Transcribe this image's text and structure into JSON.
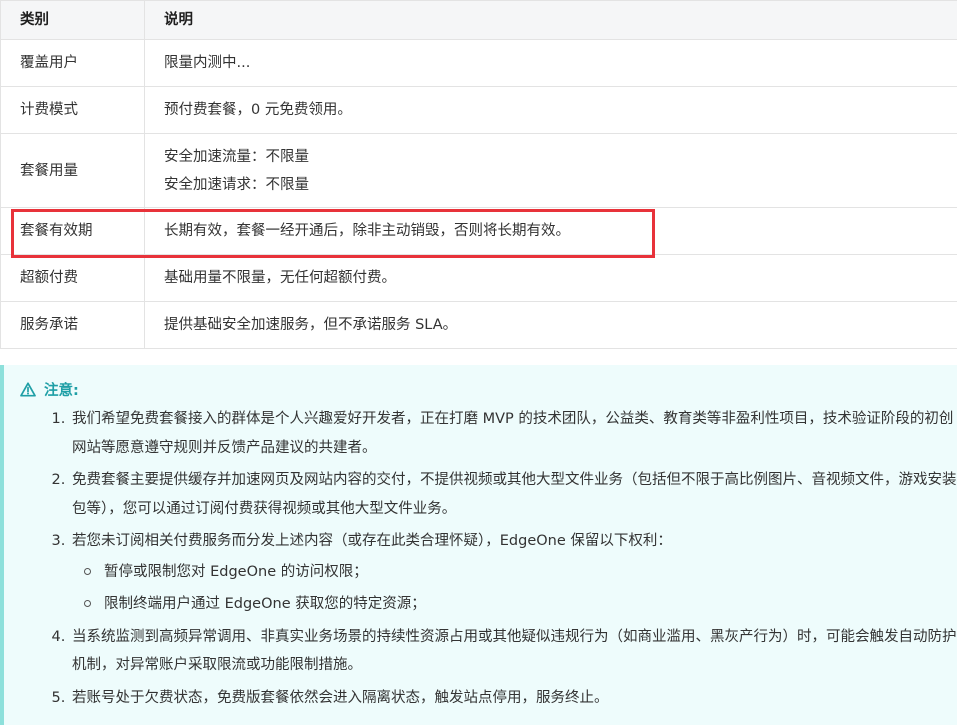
{
  "table": {
    "headers": [
      "类别",
      "说明"
    ],
    "rows": [
      {
        "category": "覆盖用户",
        "desc": [
          "限量内测中..."
        ]
      },
      {
        "category": "计费模式",
        "desc": [
          "预付费套餐，0 元免费领用。"
        ]
      },
      {
        "category": "套餐用量",
        "desc": [
          "安全加速流量：不限量",
          "安全加速请求：不限量"
        ]
      },
      {
        "category": "套餐有效期",
        "desc": [
          "长期有效，套餐一经开通后，除非主动销毁，否则将长期有效。"
        ]
      },
      {
        "category": "超额付费",
        "desc": [
          "基础用量不限量，无任何超额付费。"
        ]
      },
      {
        "category": "服务承诺",
        "desc": [
          "提供基础安全加速服务，但不承诺服务 SLA。"
        ]
      }
    ]
  },
  "notice": {
    "title": "注意:",
    "icon": "warning-triangle-icon",
    "points": [
      "我们希望免费套餐接入的群体是个人兴趣爱好开发者，正在打磨 MVP 的技术团队，公益类、教育类等非盈利性项目，技术验证阶段的初创网站等愿意遵守规则并反馈产品建议的共建者。",
      "免费套餐主要提供缓存并加速网页及网站内容的交付，不提供视频或其他大型文件业务（包括但不限于高比例图片、音视频文件，游戏安装包等），您可以通过订阅付费获得视频或其他大型文件业务。",
      "若您未订阅相关付费服务而分发上述内容（或存在此类合理怀疑），EdgeOne 保留以下权利：",
      "当系统监测到高频异常调用、非真实业务场景的持续性资源占用或其他疑似违规行为（如商业滥用、黑灰产行为）时，可能会触发自动防护机制，对异常账户采取限流或功能限制措施。",
      "若账号处于欠费状态，免费版套餐依然会进入隔离状态，触发站点停用，服务终止。"
    ],
    "sub_points": [
      "暂停或限制您对 EdgeOne 的访问权限；",
      "限制终端用户通过 EdgeOne 获取您的特定资源；"
    ]
  },
  "colors": {
    "highlight_border": "#e8323a",
    "notice_bg": "#eefcfc",
    "notice_accent": "#1f9fa6"
  }
}
